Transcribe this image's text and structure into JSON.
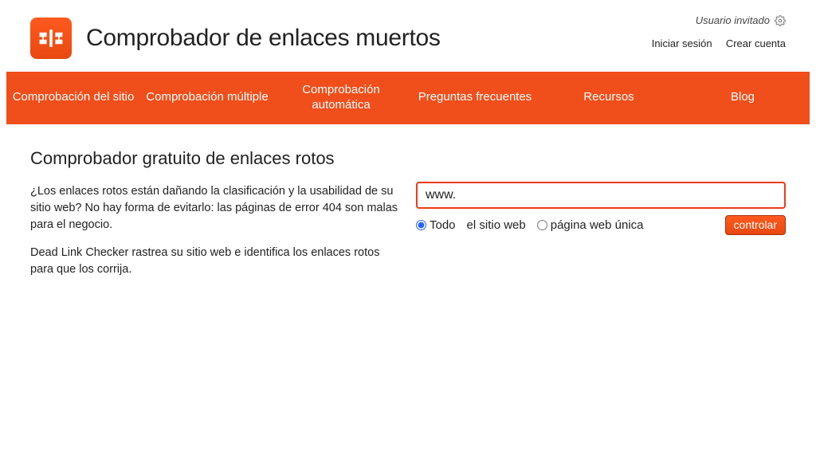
{
  "header": {
    "title": "Comprobador de enlaces muertos",
    "guest_label": "Usuario invitado",
    "login_label": "Iniciar sesión",
    "signup_label": "Crear cuenta"
  },
  "nav": {
    "items": [
      "Comprobación del sitio",
      "Comprobación múltiple",
      "Comprobación automática",
      "Preguntas frecuentes",
      "Recursos",
      "Blog"
    ]
  },
  "main": {
    "subheading": "Comprobador gratuito de enlaces rotos",
    "para1": "¿Los enlaces rotos están dañando la clasificación y la usabilidad de su sitio web? No hay forma de evitarlo: las páginas de error 404 son malas para el negocio.",
    "para2": "Dead Link Checker rastrea su sitio web e identifica los enlaces rotos para que los corrija."
  },
  "form": {
    "url_value": "www.",
    "radio_all": "Todo",
    "site_label": "el sitio web",
    "radio_single": "página web única",
    "check_button": "controlar",
    "selected": "all"
  }
}
